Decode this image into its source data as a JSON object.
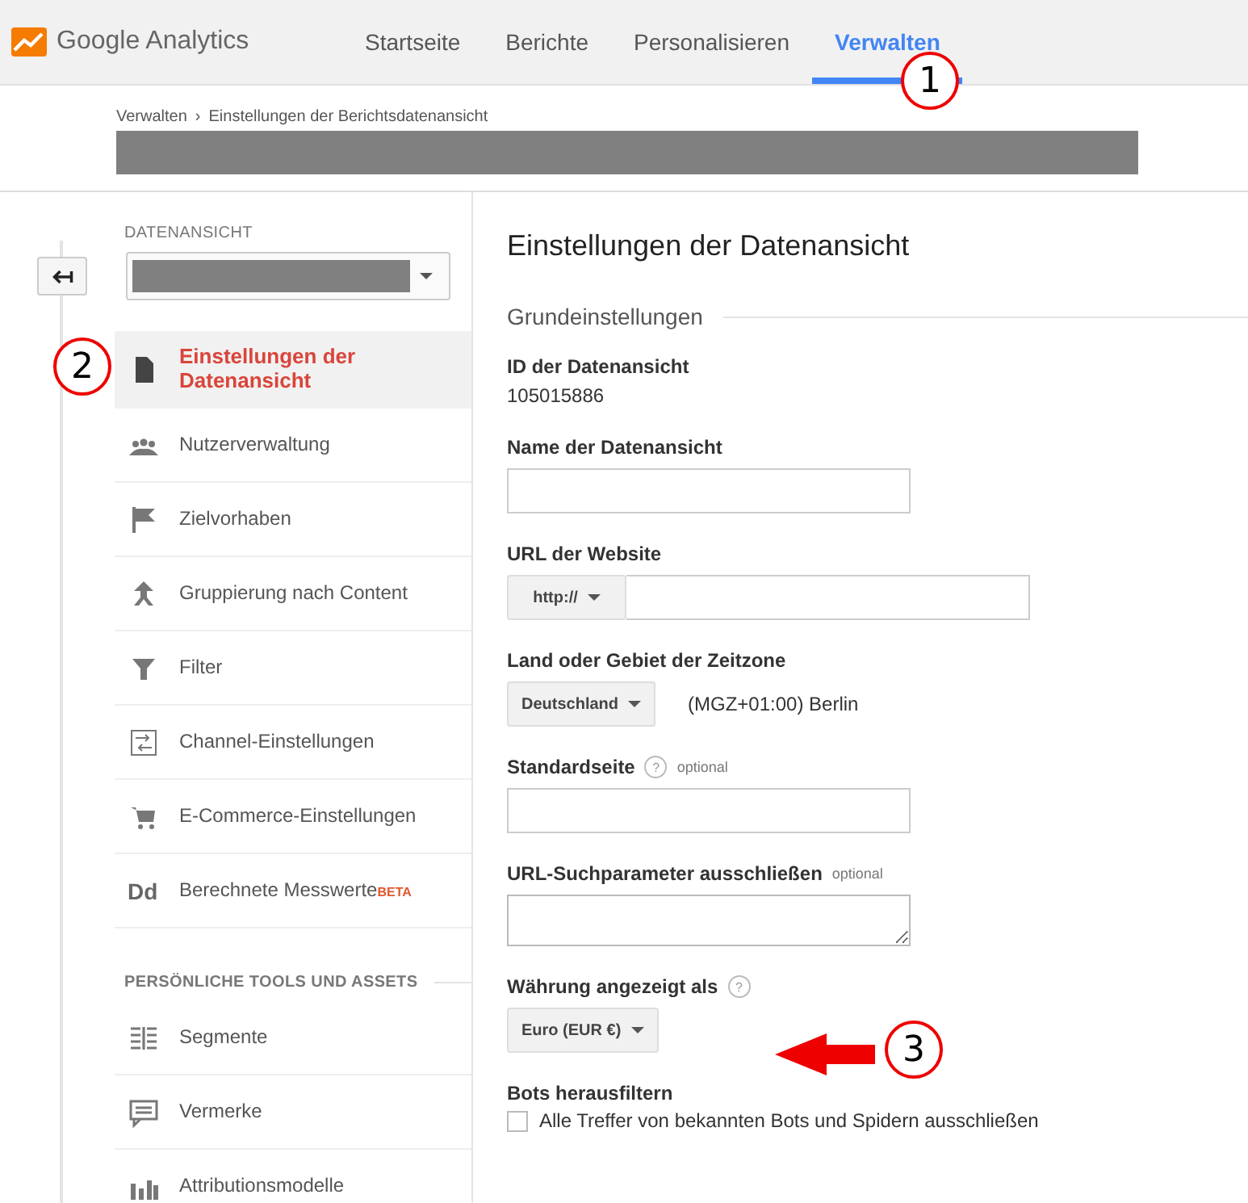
{
  "app": {
    "name": "Google Analytics"
  },
  "nav": [
    {
      "label": "Startseite",
      "selected": false
    },
    {
      "label": "Berichte",
      "selected": false
    },
    {
      "label": "Personalisieren",
      "selected": false
    },
    {
      "label": "Verwalten",
      "selected": true
    }
  ],
  "breadcrumb": {
    "items": [
      "Verwalten",
      "Einstellungen der Berichtsdatenansicht"
    ],
    "separator": "›"
  },
  "sidebar": {
    "section_label": "DATENANSICHT",
    "items": [
      {
        "label": "Einstellungen der Datenansicht",
        "selected": true
      },
      {
        "label": "Nutzerverwaltung",
        "selected": false
      },
      {
        "label": "Zielvorhaben",
        "selected": false
      },
      {
        "label": "Gruppierung nach Content",
        "selected": false
      },
      {
        "label": "Filter",
        "selected": false
      },
      {
        "label": "Channel-Einstellungen",
        "selected": false
      },
      {
        "label": "E-Commerce-Einstellungen",
        "selected": false
      },
      {
        "label": "Berechnete Messwerte",
        "selected": false,
        "glyph": "Dd",
        "badge": "BETA"
      }
    ],
    "section2_label": "PERSÖNLICHE TOOLS UND ASSETS",
    "items2": [
      {
        "label": "Segmente",
        "selected": false
      },
      {
        "label": "Vermerke",
        "selected": false
      },
      {
        "label": "Attributionsmodelle",
        "selected": false
      }
    ]
  },
  "main": {
    "title": "Einstellungen der Datenansicht",
    "section": "Grundeinstellungen",
    "fields": [
      {
        "kind": "text",
        "label": "ID der Datenansicht",
        "value": "105015886"
      },
      {
        "kind": "input",
        "label": "Name der Datenansicht"
      },
      {
        "kind": "url",
        "label": "URL der Website",
        "prefix": "http://"
      },
      {
        "kind": "select",
        "label": "Land oder Gebiet der Zeitzone",
        "value": "Deutschland",
        "note": "(MGZ+01:00) Berlin"
      },
      {
        "kind": "input",
        "label": "Standardseite",
        "help": "?",
        "optional": "optional"
      },
      {
        "kind": "textarea",
        "label": "URL-Suchparameter ausschließen",
        "optional": "optional"
      },
      {
        "kind": "select",
        "label": "Währung angezeigt als",
        "help": "?",
        "value": "Euro (EUR €)"
      },
      {
        "kind": "checkbox",
        "label": "Bots herausfiltern",
        "text": "Alle Treffer von bekannten Bots und Spidern ausschließen",
        "checked": false
      }
    ]
  },
  "annotations": [
    {
      "number": "1"
    },
    {
      "number": "2"
    },
    {
      "number": "3",
      "arrow": true
    }
  ]
}
